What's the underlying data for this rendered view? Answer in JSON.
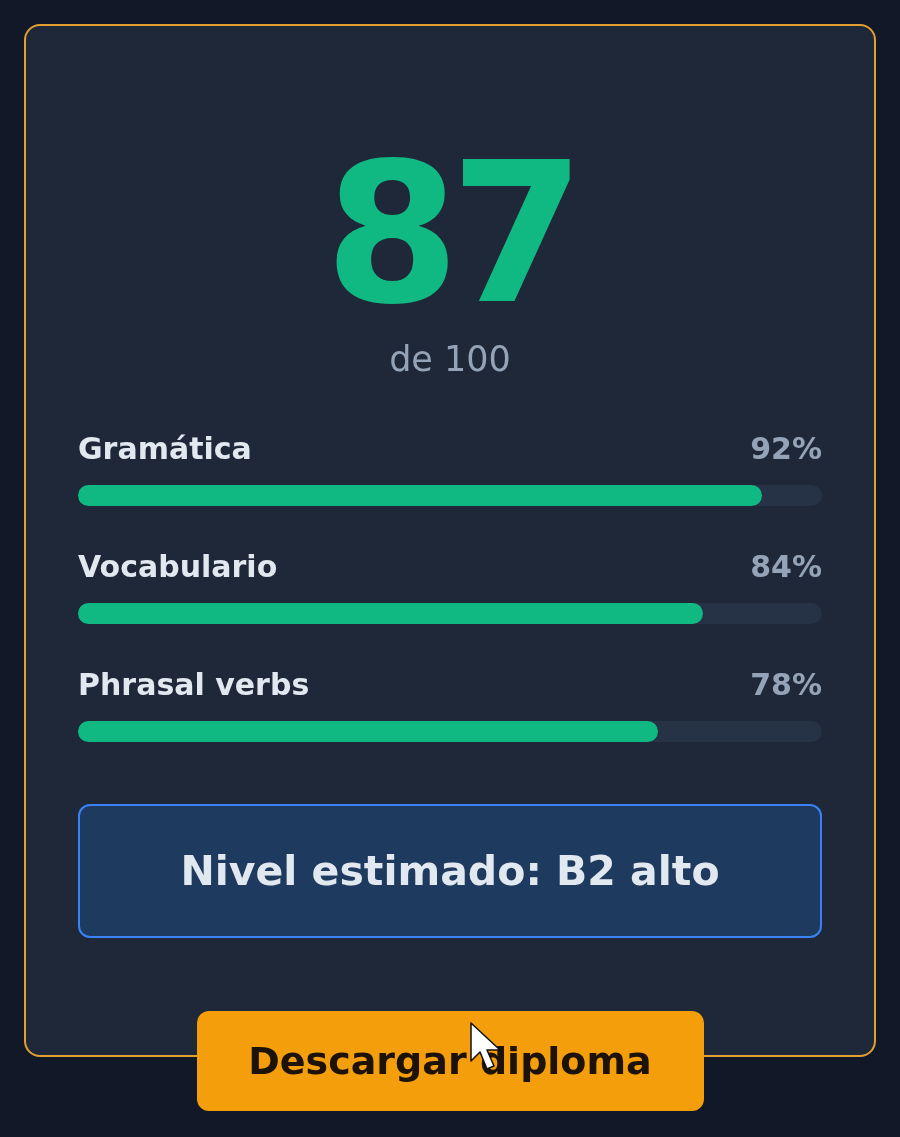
{
  "score": {
    "value": "87",
    "caption": "de 100"
  },
  "skills": [
    {
      "name": "Gramática",
      "reading": "92%",
      "level": 0.92
    },
    {
      "name": "Vocabulario",
      "reading": "84%",
      "level": 0.84
    },
    {
      "name": "Phrasal verbs",
      "reading": "78%",
      "level": 0.78
    }
  ],
  "level_banner": {
    "text": "Nivel estimado: B2 alto"
  },
  "button": {
    "label": "Descargar diploma"
  }
}
